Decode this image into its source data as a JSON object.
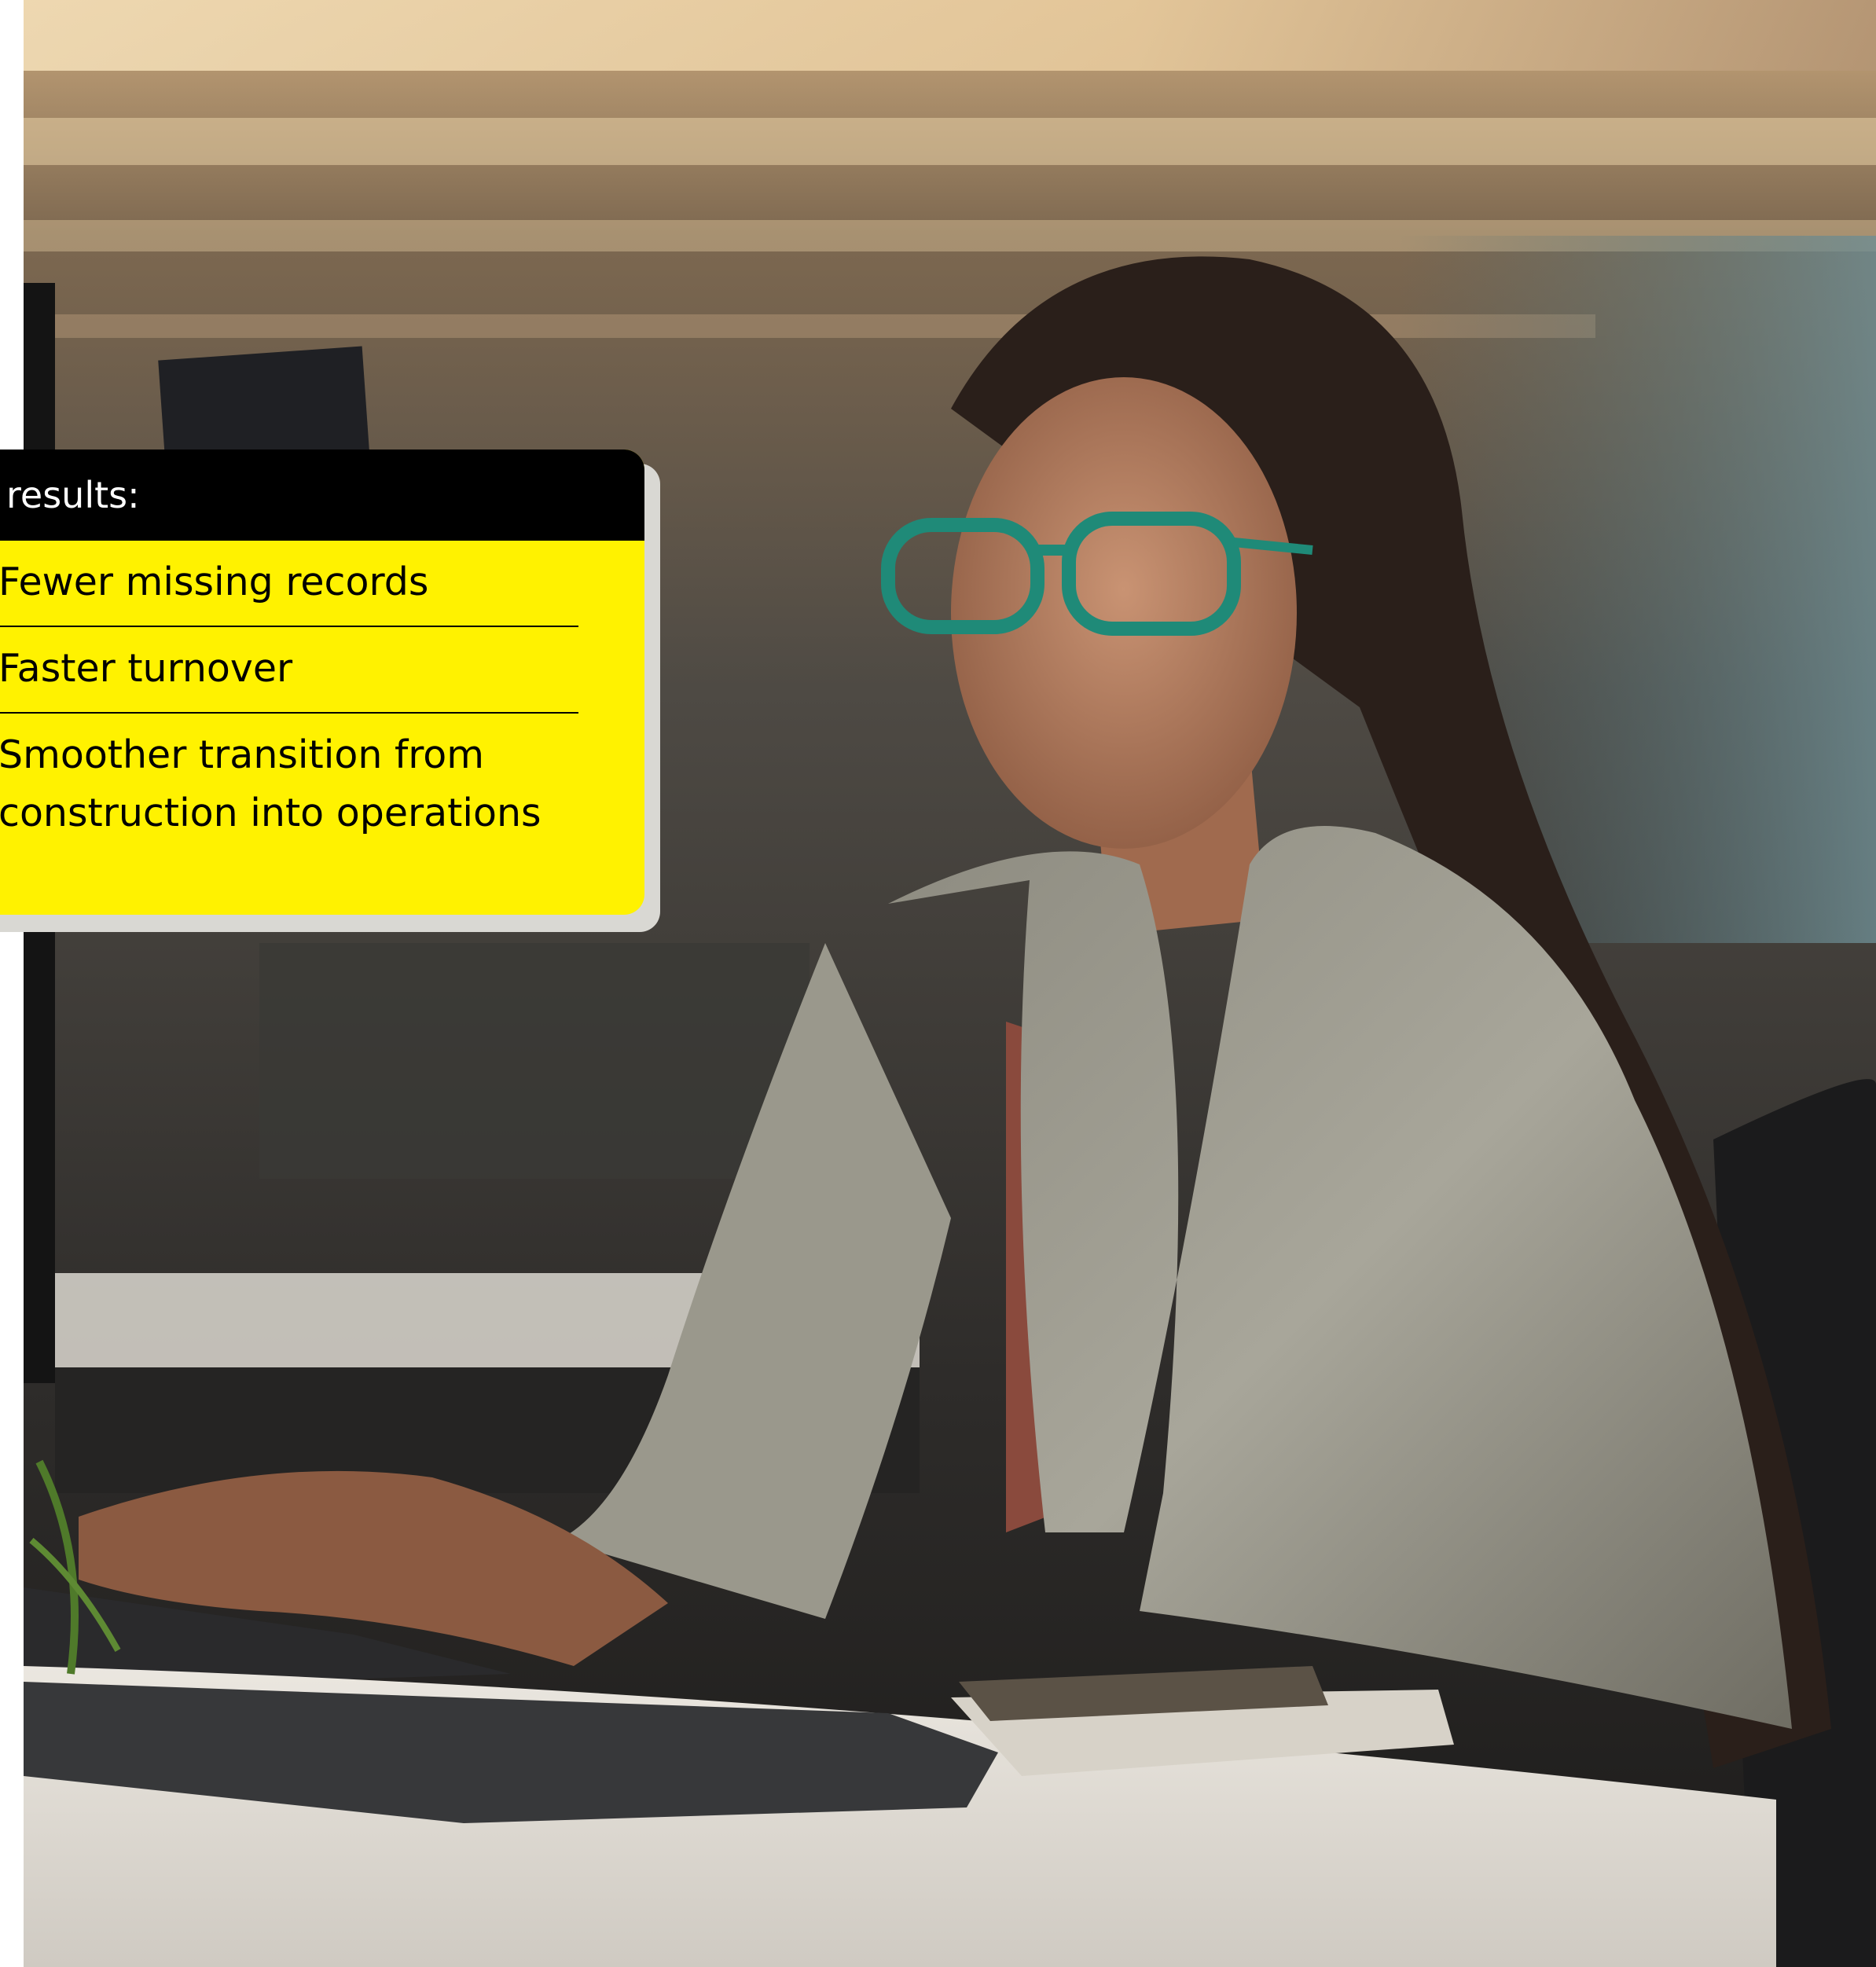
{
  "card": {
    "header": "results:",
    "items": [
      {
        "label": "Fewer missing records"
      },
      {
        "label": "Faster turnover"
      },
      {
        "label": "Smoother transition from construction into operations"
      }
    ],
    "colors": {
      "header_bg": "#000000",
      "body_bg": "#fff200",
      "text": "#000000"
    }
  },
  "photo": {
    "subject_icon": "office-worker-photo"
  }
}
